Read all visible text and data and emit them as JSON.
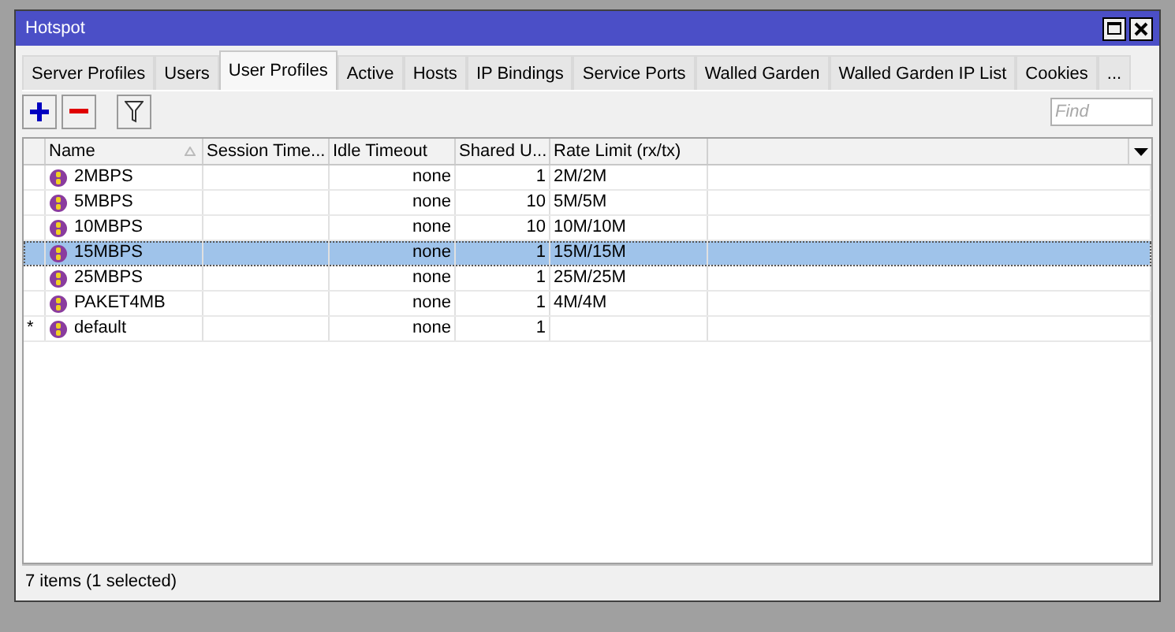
{
  "window": {
    "title": "Hotspot"
  },
  "tabs": [
    {
      "label": "Server Profiles",
      "selected": false
    },
    {
      "label": "Users",
      "selected": false
    },
    {
      "label": "User Profiles",
      "selected": true
    },
    {
      "label": "Active",
      "selected": false
    },
    {
      "label": "Hosts",
      "selected": false
    },
    {
      "label": "IP Bindings",
      "selected": false
    },
    {
      "label": "Service Ports",
      "selected": false
    },
    {
      "label": "Walled Garden",
      "selected": false
    },
    {
      "label": "Walled Garden IP List",
      "selected": false
    },
    {
      "label": "Cookies",
      "selected": false
    },
    {
      "label": "...",
      "selected": false
    }
  ],
  "search": {
    "placeholder": "Find"
  },
  "table": {
    "columns": [
      "Name",
      "Session Time...",
      "Idle Timeout",
      "Shared U...",
      "Rate Limit (rx/tx)"
    ],
    "rows": [
      {
        "marker": "",
        "name": "2MBPS",
        "session_timeout": "",
        "idle_timeout": "none",
        "shared_users": "1",
        "rate_limit": "2M/2M",
        "selected": false
      },
      {
        "marker": "",
        "name": "5MBPS",
        "session_timeout": "",
        "idle_timeout": "none",
        "shared_users": "10",
        "rate_limit": "5M/5M",
        "selected": false
      },
      {
        "marker": "",
        "name": "10MBPS",
        "session_timeout": "",
        "idle_timeout": "none",
        "shared_users": "10",
        "rate_limit": "10M/10M",
        "selected": false
      },
      {
        "marker": "",
        "name": "15MBPS",
        "session_timeout": "",
        "idle_timeout": "none",
        "shared_users": "1",
        "rate_limit": "15M/15M",
        "selected": true
      },
      {
        "marker": "",
        "name": "25MBPS",
        "session_timeout": "",
        "idle_timeout": "none",
        "shared_users": "1",
        "rate_limit": "25M/25M",
        "selected": false
      },
      {
        "marker": "",
        "name": "PAKET4MB",
        "session_timeout": "",
        "idle_timeout": "none",
        "shared_users": "1",
        "rate_limit": "4M/4M",
        "selected": false
      },
      {
        "marker": "*",
        "name": "default",
        "session_timeout": "",
        "idle_timeout": "none",
        "shared_users": "1",
        "rate_limit": "",
        "selected": false
      }
    ]
  },
  "status_bar": "7 items (1 selected)"
}
